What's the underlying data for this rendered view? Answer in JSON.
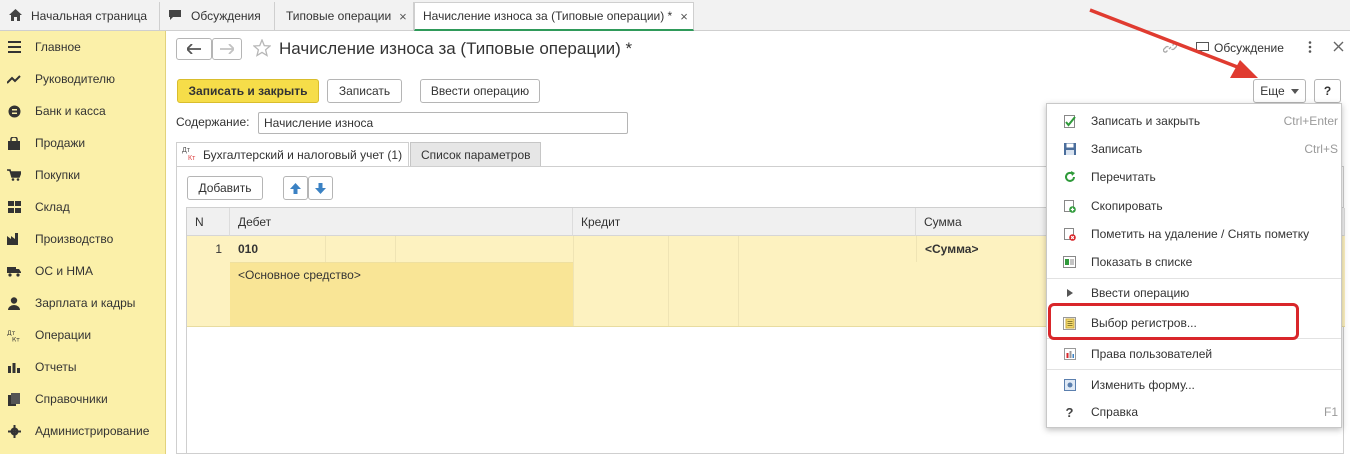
{
  "top_tabs": {
    "home": "Начальная страница",
    "discussions": "Обсуждения",
    "typical_ops": "Типовые операции",
    "current": "Начисление износа за (Типовые операции) *",
    "close_glyph": "×"
  },
  "sidebar": {
    "items": [
      {
        "label": "Главное",
        "icon": "menu-icon"
      },
      {
        "label": "Руководителю",
        "icon": "trend-icon"
      },
      {
        "label": "Банк и касса",
        "icon": "coin-icon"
      },
      {
        "label": "Продажи",
        "icon": "bag-icon"
      },
      {
        "label": "Покупки",
        "icon": "cart-icon"
      },
      {
        "label": "Склад",
        "icon": "warehouse-icon"
      },
      {
        "label": "Производство",
        "icon": "factory-icon"
      },
      {
        "label": "ОС и НМА",
        "icon": "truck-icon"
      },
      {
        "label": "Зарплата и кадры",
        "icon": "person-icon"
      },
      {
        "label": "Операции",
        "icon": "dt-kt-icon"
      },
      {
        "label": "Отчеты",
        "icon": "chart-icon"
      },
      {
        "label": "Справочники",
        "icon": "books-icon"
      },
      {
        "label": "Администрирование",
        "icon": "gear-icon"
      }
    ]
  },
  "form": {
    "title": "Начисление износа за (Типовые операции) *",
    "discussion_label": "Обсуждение",
    "buttons": {
      "save_close": "Записать и закрыть",
      "save": "Записать",
      "enter_operation": "Ввести операцию",
      "more": "Еще",
      "help": "?",
      "add": "Добавить"
    },
    "content_label": "Содержание:",
    "content_value": "Начисление износа",
    "tabs": [
      "Бухгалтерский и налоговый учет (1)",
      "Список параметров"
    ],
    "dt_kt_badge": {
      "top": "Дт",
      "bottom": "Кт"
    }
  },
  "table": {
    "columns": [
      "N",
      "Дебет",
      "Кредит",
      "Сумма"
    ],
    "rows": [
      {
        "n": "1",
        "debit": "010",
        "debit_sub": "<Основное средство>",
        "credit": "",
        "sum": "<Сумма>"
      }
    ]
  },
  "menu": {
    "items": [
      {
        "label": "Записать и закрыть",
        "shortcut": "Ctrl+Enter",
        "icon": "save-close-icon"
      },
      {
        "label": "Записать",
        "shortcut": "Ctrl+S",
        "icon": "floppy-icon"
      },
      {
        "label": "Перечитать",
        "shortcut": "",
        "icon": "refresh-icon"
      },
      {
        "label": "Скопировать",
        "shortcut": "",
        "icon": "copy-icon"
      },
      {
        "label": "Пометить на удаление / Снять пометку",
        "shortcut": "",
        "icon": "delete-mark-icon"
      },
      {
        "label": "Показать в списке",
        "shortcut": "",
        "icon": "show-list-icon"
      },
      {
        "label": "Ввести операцию",
        "shortcut": "",
        "icon": "triangle-right-icon"
      },
      {
        "label": "Выбор регистров...",
        "shortcut": "",
        "icon": "registers-icon"
      },
      {
        "label": "Права пользователей",
        "shortcut": "",
        "icon": "rights-icon"
      },
      {
        "label": "Изменить форму...",
        "shortcut": "",
        "icon": "form-icon"
      },
      {
        "label": "Справка",
        "shortcut": "F1",
        "icon": "question-icon"
      }
    ]
  },
  "colors": {
    "sidebar_bg": "#fbf0a9",
    "primary_button": "#f6dd49",
    "active_tab_underline": "#2f9a5a",
    "highlight_box": "#d9262a",
    "arrow": "#e03b30",
    "row_highlight": "#fdf2c0",
    "cell_selected": "#f9e596"
  }
}
